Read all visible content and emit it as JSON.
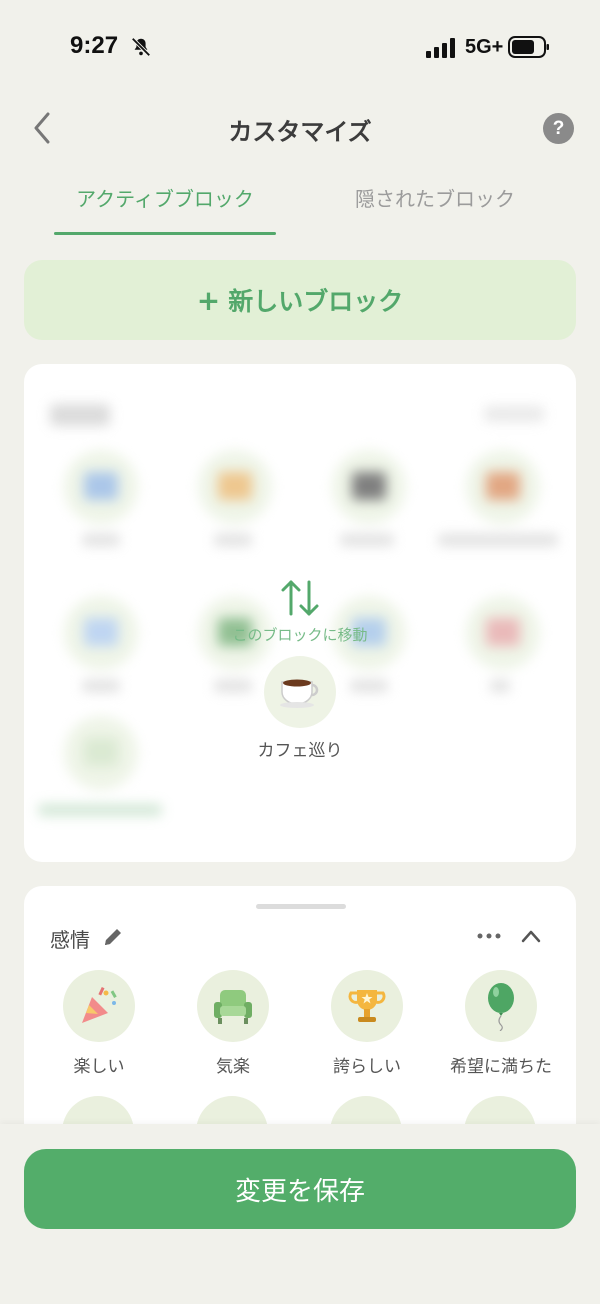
{
  "status_bar": {
    "time": "9:27",
    "network": "5G+"
  },
  "header": {
    "title": "カスタマイズ",
    "help_label": "?"
  },
  "tabs": [
    {
      "label": "アクティブブロック",
      "active": true
    },
    {
      "label": "隠されたブロック",
      "active": false
    }
  ],
  "new_block": {
    "plus": "+",
    "label": "新しいブロック"
  },
  "move_hint": "このブロックに移動",
  "dragged_item": {
    "label": "カフェ巡り",
    "icon": "coffee-cup-icon"
  },
  "emotions": {
    "title": "感情",
    "items": [
      {
        "label": "楽しい",
        "icon": "party-popper-icon"
      },
      {
        "label": "気楽",
        "icon": "armchair-icon"
      },
      {
        "label": "誇らしい",
        "icon": "trophy-icon"
      },
      {
        "label": "希望に満ちた",
        "icon": "balloon-icon"
      }
    ]
  },
  "save_button": "変更を保存",
  "colors": {
    "accent": "#53ad6a",
    "accent_light": "#e2f0d6",
    "background": "#f1f1eb"
  }
}
